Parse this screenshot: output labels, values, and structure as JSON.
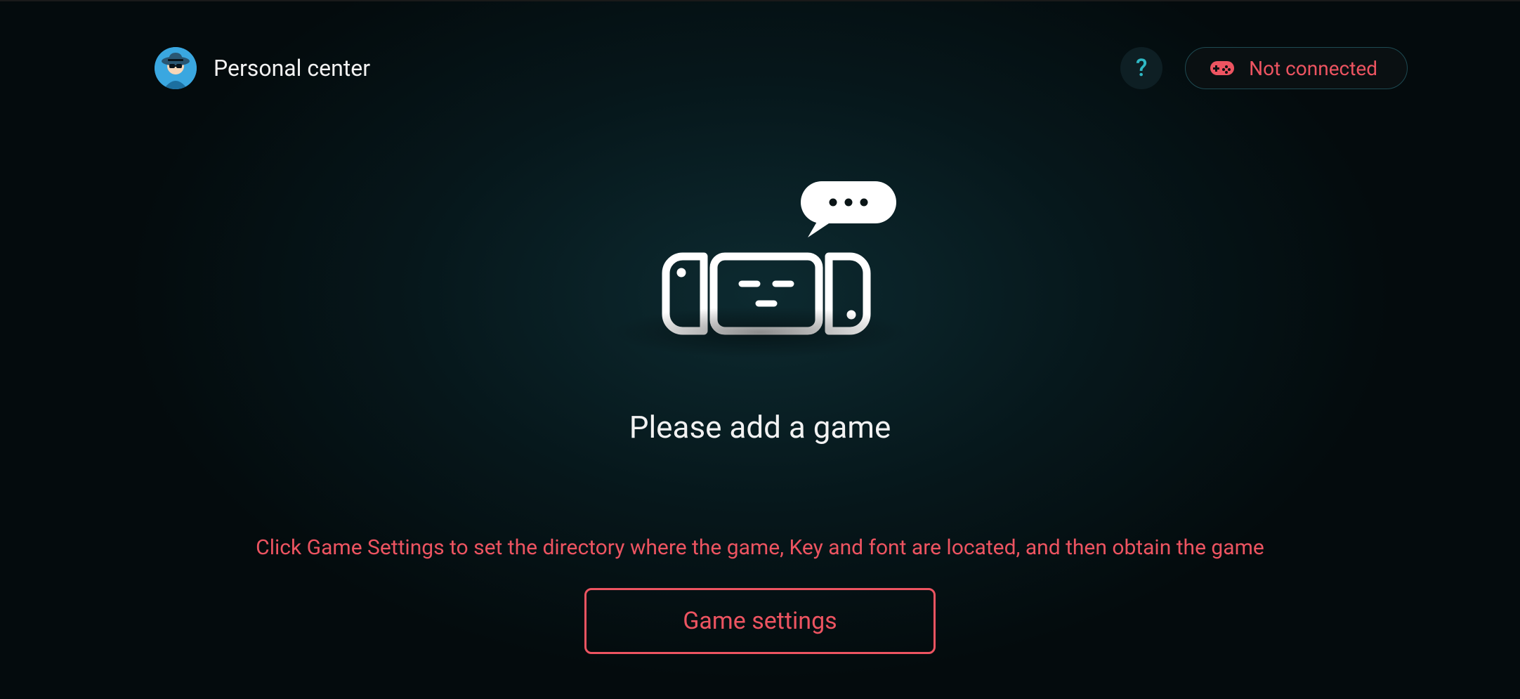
{
  "header": {
    "title": "Personal center",
    "help_label": "?",
    "status_label": "Not connected"
  },
  "main": {
    "title": "Please add a game",
    "instruction": "Click Game Settings to set the directory where the game, Key and font are located, and then obtain the game",
    "cta_label": "Game settings"
  },
  "colors": {
    "accent": "#ed5461",
    "help": "#2fb8c4"
  }
}
